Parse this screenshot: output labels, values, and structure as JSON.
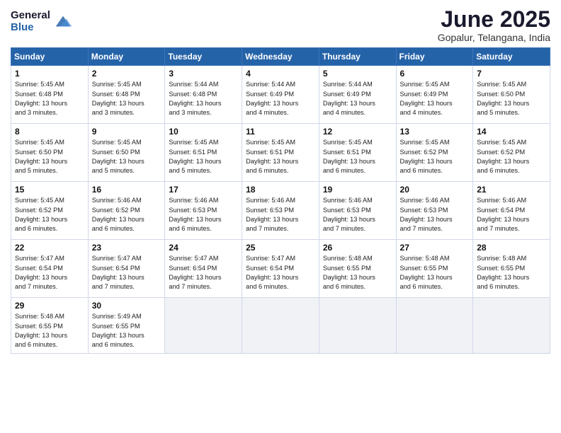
{
  "logo": {
    "general": "General",
    "blue": "Blue"
  },
  "title": "June 2025",
  "subtitle": "Gopalur, Telangana, India",
  "weekdays": [
    "Sunday",
    "Monday",
    "Tuesday",
    "Wednesday",
    "Thursday",
    "Friday",
    "Saturday"
  ],
  "weeks": [
    [
      {
        "day": "1",
        "sunrise": "5:45 AM",
        "sunset": "6:48 PM",
        "daylight": "13 hours and 3 minutes."
      },
      {
        "day": "2",
        "sunrise": "5:45 AM",
        "sunset": "6:48 PM",
        "daylight": "13 hours and 3 minutes."
      },
      {
        "day": "3",
        "sunrise": "5:44 AM",
        "sunset": "6:48 PM",
        "daylight": "13 hours and 3 minutes."
      },
      {
        "day": "4",
        "sunrise": "5:44 AM",
        "sunset": "6:49 PM",
        "daylight": "13 hours and 4 minutes."
      },
      {
        "day": "5",
        "sunrise": "5:44 AM",
        "sunset": "6:49 PM",
        "daylight": "13 hours and 4 minutes."
      },
      {
        "day": "6",
        "sunrise": "5:45 AM",
        "sunset": "6:49 PM",
        "daylight": "13 hours and 4 minutes."
      },
      {
        "day": "7",
        "sunrise": "5:45 AM",
        "sunset": "6:50 PM",
        "daylight": "13 hours and 5 minutes."
      }
    ],
    [
      {
        "day": "8",
        "sunrise": "5:45 AM",
        "sunset": "6:50 PM",
        "daylight": "13 hours and 5 minutes."
      },
      {
        "day": "9",
        "sunrise": "5:45 AM",
        "sunset": "6:50 PM",
        "daylight": "13 hours and 5 minutes."
      },
      {
        "day": "10",
        "sunrise": "5:45 AM",
        "sunset": "6:51 PM",
        "daylight": "13 hours and 5 minutes."
      },
      {
        "day": "11",
        "sunrise": "5:45 AM",
        "sunset": "6:51 PM",
        "daylight": "13 hours and 6 minutes."
      },
      {
        "day": "12",
        "sunrise": "5:45 AM",
        "sunset": "6:51 PM",
        "daylight": "13 hours and 6 minutes."
      },
      {
        "day": "13",
        "sunrise": "5:45 AM",
        "sunset": "6:52 PM",
        "daylight": "13 hours and 6 minutes."
      },
      {
        "day": "14",
        "sunrise": "5:45 AM",
        "sunset": "6:52 PM",
        "daylight": "13 hours and 6 minutes."
      }
    ],
    [
      {
        "day": "15",
        "sunrise": "5:45 AM",
        "sunset": "6:52 PM",
        "daylight": "13 hours and 6 minutes."
      },
      {
        "day": "16",
        "sunrise": "5:46 AM",
        "sunset": "6:52 PM",
        "daylight": "13 hours and 6 minutes."
      },
      {
        "day": "17",
        "sunrise": "5:46 AM",
        "sunset": "6:53 PM",
        "daylight": "13 hours and 6 minutes."
      },
      {
        "day": "18",
        "sunrise": "5:46 AM",
        "sunset": "6:53 PM",
        "daylight": "13 hours and 7 minutes."
      },
      {
        "day": "19",
        "sunrise": "5:46 AM",
        "sunset": "6:53 PM",
        "daylight": "13 hours and 7 minutes."
      },
      {
        "day": "20",
        "sunrise": "5:46 AM",
        "sunset": "6:53 PM",
        "daylight": "13 hours and 7 minutes."
      },
      {
        "day": "21",
        "sunrise": "5:46 AM",
        "sunset": "6:54 PM",
        "daylight": "13 hours and 7 minutes."
      }
    ],
    [
      {
        "day": "22",
        "sunrise": "5:47 AM",
        "sunset": "6:54 PM",
        "daylight": "13 hours and 7 minutes."
      },
      {
        "day": "23",
        "sunrise": "5:47 AM",
        "sunset": "6:54 PM",
        "daylight": "13 hours and 7 minutes."
      },
      {
        "day": "24",
        "sunrise": "5:47 AM",
        "sunset": "6:54 PM",
        "daylight": "13 hours and 7 minutes."
      },
      {
        "day": "25",
        "sunrise": "5:47 AM",
        "sunset": "6:54 PM",
        "daylight": "13 hours and 6 minutes."
      },
      {
        "day": "26",
        "sunrise": "5:48 AM",
        "sunset": "6:55 PM",
        "daylight": "13 hours and 6 minutes."
      },
      {
        "day": "27",
        "sunrise": "5:48 AM",
        "sunset": "6:55 PM",
        "daylight": "13 hours and 6 minutes."
      },
      {
        "day": "28",
        "sunrise": "5:48 AM",
        "sunset": "6:55 PM",
        "daylight": "13 hours and 6 minutes."
      }
    ],
    [
      {
        "day": "29",
        "sunrise": "5:48 AM",
        "sunset": "6:55 PM",
        "daylight": "13 hours and 6 minutes."
      },
      {
        "day": "30",
        "sunrise": "5:49 AM",
        "sunset": "6:55 PM",
        "daylight": "13 hours and 6 minutes."
      },
      null,
      null,
      null,
      null,
      null
    ]
  ]
}
